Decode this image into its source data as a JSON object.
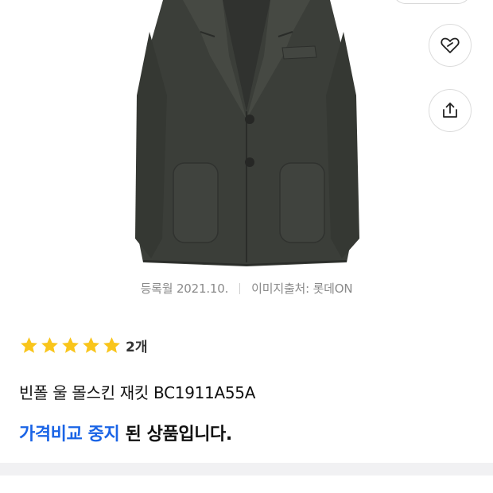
{
  "product": {
    "title": "빈폴 울 몰스킨 재킷 BC1911A55A",
    "meta": {
      "registered": "등록월 2021.10.",
      "image_source": "이미지출처: 롯데ON"
    },
    "rating": {
      "stars": 5,
      "max": 5,
      "count_text": "2개"
    },
    "status": {
      "highlight": "가격비교 중지",
      "rest": " 된 상품입니다."
    }
  },
  "actions": {
    "wishlist_icon": "heart-tag-icon",
    "share_icon": "share-upload-icon"
  },
  "colors": {
    "accent": "#1a64e6",
    "star": "#f9c51b",
    "jacket": "#3b3e39"
  }
}
